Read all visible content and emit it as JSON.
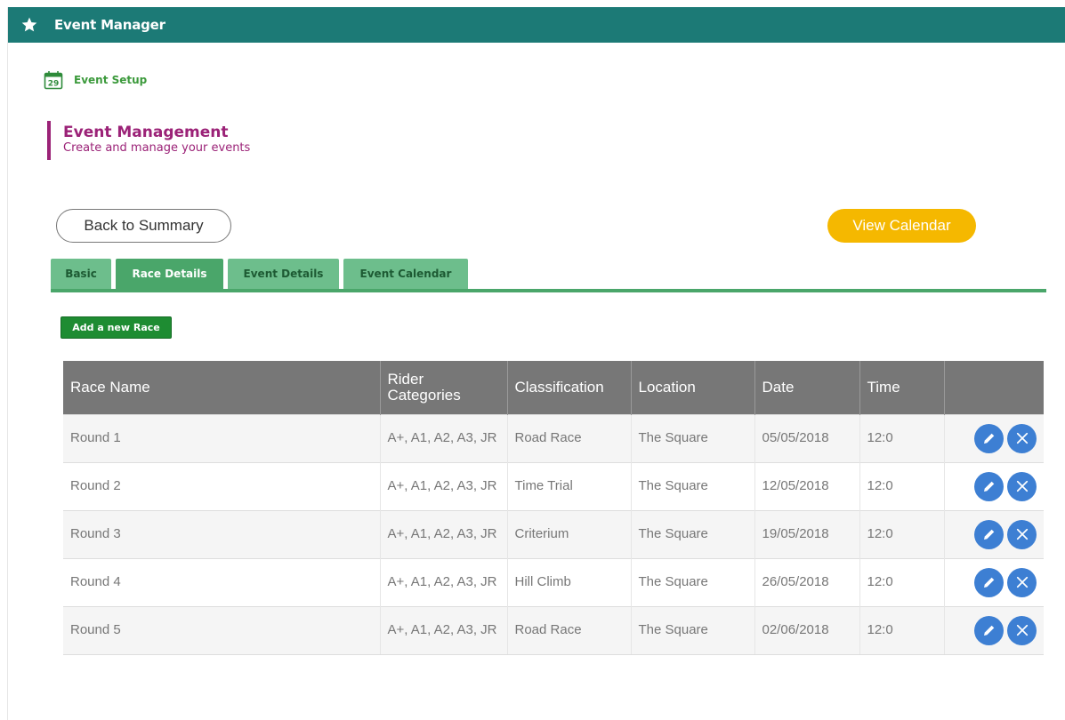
{
  "app": {
    "title": "Event Manager"
  },
  "breadcrumb": {
    "label": "Event Setup",
    "calendar_day": "29"
  },
  "page": {
    "title": "Event Management",
    "subtitle": "Create and manage your events"
  },
  "buttons": {
    "back": "Back to Summary",
    "view_calendar": "View Calendar",
    "add_race": "Add a new Race"
  },
  "tabs": [
    {
      "label": "Basic",
      "active": false
    },
    {
      "label": "Race Details",
      "active": true
    },
    {
      "label": "Event Details",
      "active": false
    },
    {
      "label": "Event Calendar",
      "active": false
    }
  ],
  "table": {
    "headers": [
      "Race Name",
      "Rider Categories",
      "Classification",
      "Location",
      "Date",
      "Time",
      ""
    ],
    "rows": [
      {
        "name": "Round 1",
        "categories": "A+, A1, A2, A3, JR",
        "classification": "Road Race",
        "location": "The Square",
        "date": "05/05/2018",
        "time": "12:0"
      },
      {
        "name": "Round 2",
        "categories": "A+, A1, A2, A3, JR",
        "classification": "Time Trial",
        "location": "The Square",
        "date": "12/05/2018",
        "time": "12:0"
      },
      {
        "name": "Round 3",
        "categories": "A+, A1, A2, A3, JR",
        "classification": "Criterium",
        "location": "The Square",
        "date": "19/05/2018",
        "time": "12:0"
      },
      {
        "name": "Round 4",
        "categories": "A+, A1, A2, A3, JR",
        "classification": "Hill Climb",
        "location": "The Square",
        "date": "26/05/2018",
        "time": "12:0"
      },
      {
        "name": "Round 5",
        "categories": "A+, A1, A2, A3, JR",
        "classification": "Road Race",
        "location": "The Square",
        "date": "02/06/2018",
        "time": "12:0"
      }
    ]
  },
  "icons": {
    "title": "star-icon",
    "breadcrumb": "calendar-icon",
    "edit": "pencil-icon",
    "delete": "close-icon"
  },
  "colors": {
    "header": "#1c7a76",
    "heading": "#9b2277",
    "tab": "#6dbe8c",
    "tab_active": "#4aa66a",
    "add_button": "#1e8c32",
    "calendar_button": "#f5b800",
    "action_icon": "#3d7fd3"
  }
}
